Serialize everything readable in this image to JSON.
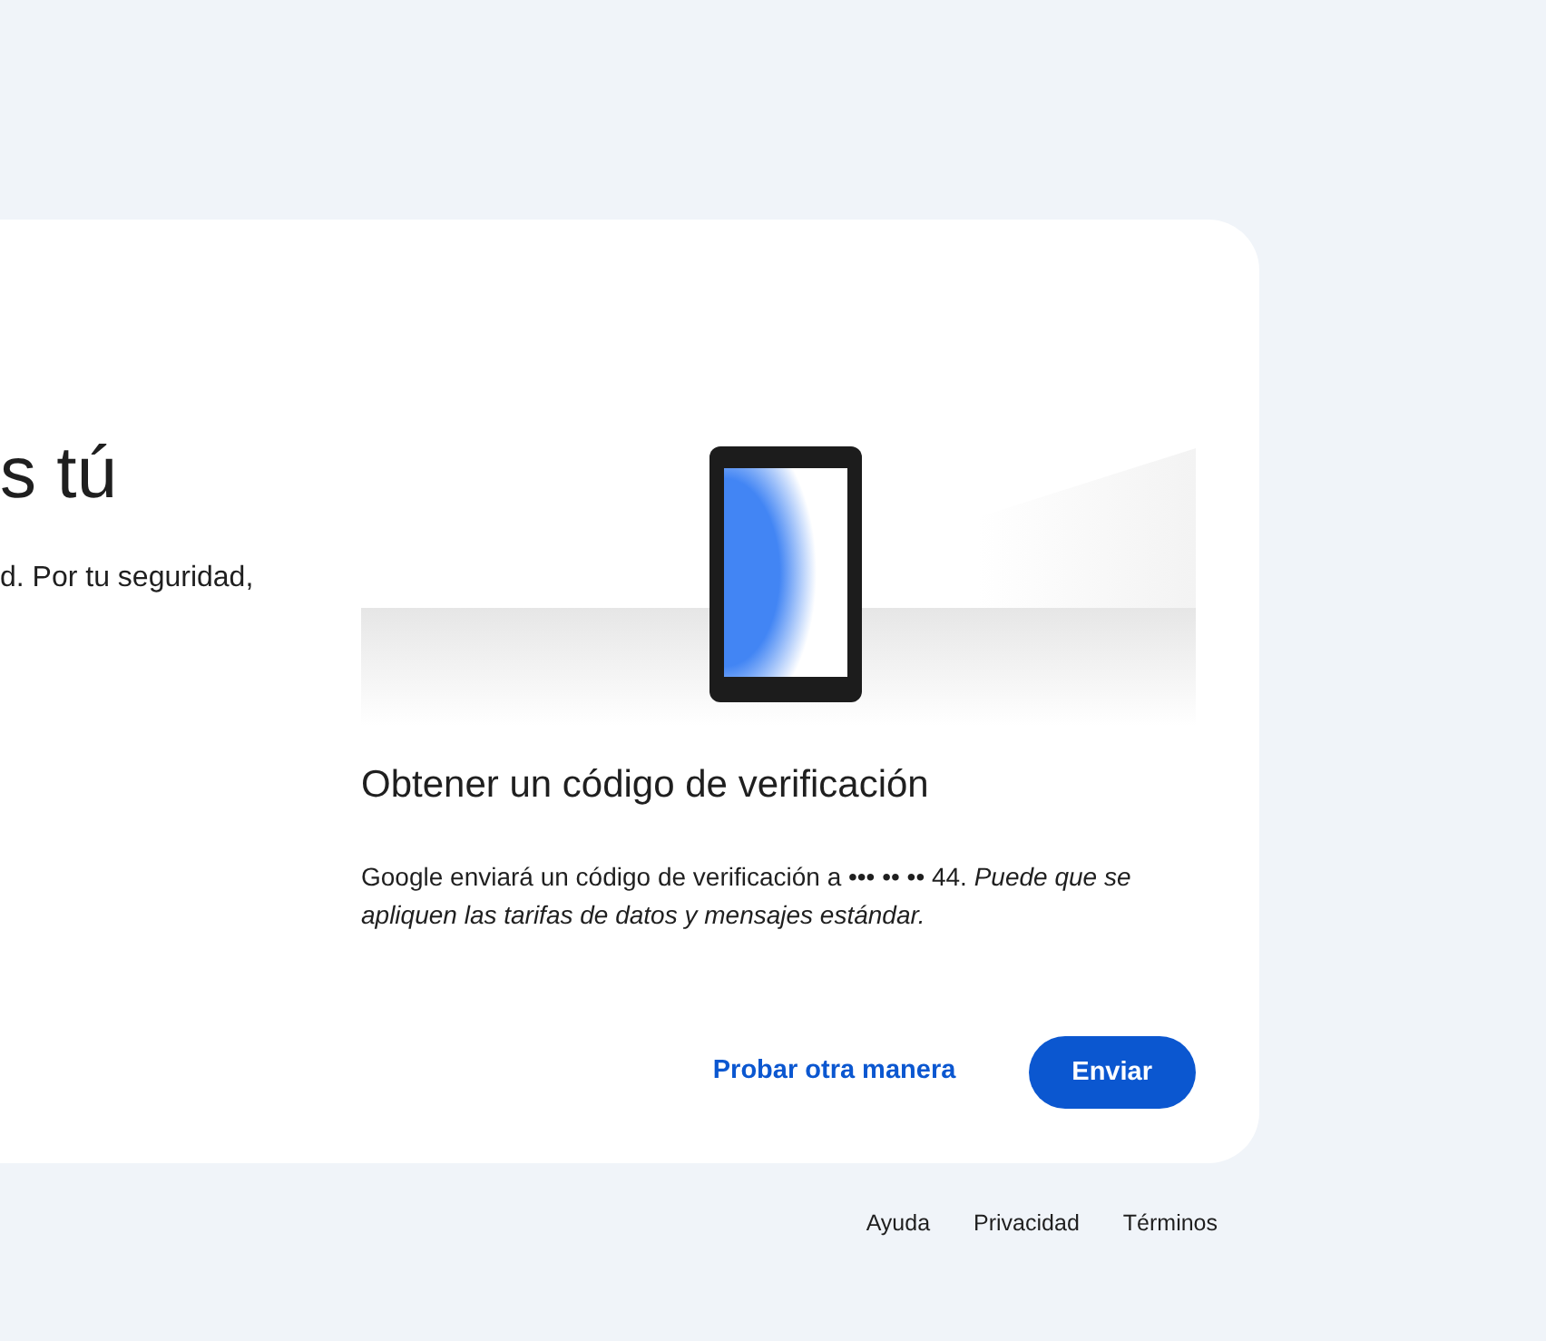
{
  "intro": {
    "heading": "s tú",
    "text": "d. Por tu seguridad,"
  },
  "method": {
    "title": "Obtener un código de verificación",
    "description": "Google enviará un código de verificación a ••• •• •• 44. *Puede que se apliquen las tarifas de datos y mensajes estándar.*"
  },
  "buttons": [
    {
      "kind": "text",
      "label": "Probar otra manera"
    },
    {
      "kind": "filled",
      "label": "Enviar"
    }
  ],
  "footer_links": [
    "Ayuda",
    "Privacidad",
    "Términos"
  ]
}
